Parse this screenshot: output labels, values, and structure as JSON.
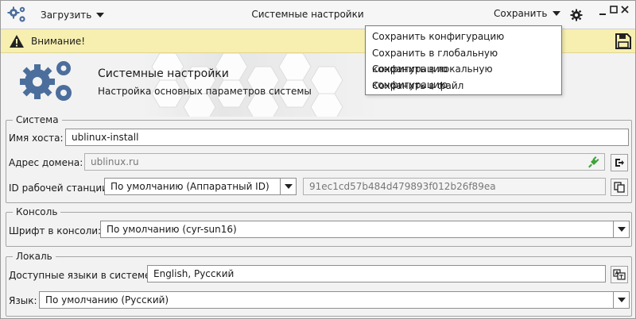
{
  "header": {
    "load_label": "Загрузить",
    "title": "Системные настройки",
    "save_label": "Сохранить"
  },
  "save_menu": {
    "items": [
      {
        "label": "Сохранить конфигурацию"
      },
      {
        "label": "Сохранить в глобальную конфигурацию"
      },
      {
        "label": "Сохранить в локальную конфигурацию"
      },
      {
        "label": "Сохранить в файл"
      }
    ]
  },
  "warning": {
    "text": "Внимание!"
  },
  "banner": {
    "title": "Системные настройки",
    "subtitle": "Настройка основных параметров системы"
  },
  "system": {
    "legend": "Система",
    "hostname_label": "Имя хоста:",
    "hostname_value": "ublinux-install",
    "domain_label": "Адрес домена:",
    "domain_placeholder": "ublinux.ru",
    "workstation_label": "ID рабочей станции:",
    "workstation_select": "По умолчанию (Аппаратный ID)",
    "workstation_id_placeholder": "91ec1cd57b484d479893f012b26f89ea"
  },
  "console": {
    "legend": "Консоль",
    "font_label": "Шрифт в консоли:",
    "font_select": "По умолчанию (cyr-sun16)"
  },
  "locale": {
    "legend": "Локаль",
    "languages_label": "Доступные языки в системе:",
    "languages_value": "English, Русский",
    "language_label": "Язык:",
    "language_select": "По умолчанию (Русский)"
  },
  "colors": {
    "warning_bg": "#f7efb0",
    "gear_blue": "#4b6e9c",
    "plug_green": "#3aa537"
  }
}
